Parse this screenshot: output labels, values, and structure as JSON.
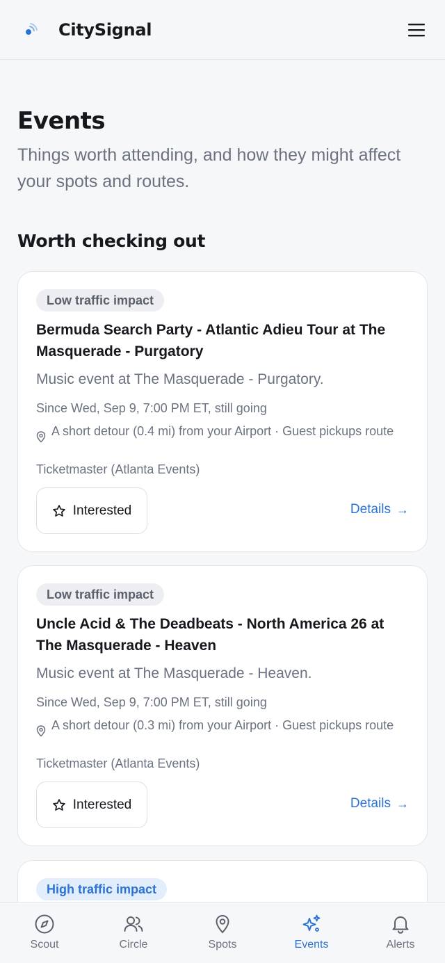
{
  "app": {
    "name": "CitySignal",
    "accent": "#2b73d6"
  },
  "header": {
    "menu_icon": "hamburger-menu-icon"
  },
  "page": {
    "title": "Events",
    "subtitle": "Things worth attending, and how they might affect your spots and routes.",
    "section_title": "Worth checking out"
  },
  "events": [
    {
      "badge": "Low traffic impact",
      "badge_level": "low",
      "title": "Bermuda Search Party - Atlantic Adieu Tour at The Masquerade - Purgatory",
      "description": "Music event at The Masquerade - Purgatory.",
      "when": "Since Wed, Sep 9, 7:00 PM ET, still going",
      "location": "A short detour (0.4 mi) from your Airport · Guest pickups route",
      "source": "Ticketmaster (Atlanta Events)",
      "interested_label": "Interested",
      "details_label": "Details"
    },
    {
      "badge": "Low traffic impact",
      "badge_level": "low",
      "title": "Uncle Acid & The Deadbeats - North America 26 at The Masquerade - Heaven",
      "description": "Music event at The Masquerade - Heaven.",
      "when": "Since Wed, Sep 9, 7:00 PM ET, still going",
      "location": "A short detour (0.3 mi) from your Airport · Guest pickups route",
      "source": "Ticketmaster (Atlanta Events)",
      "interested_label": "Interested",
      "details_label": "Details"
    },
    {
      "badge": "High traffic impact",
      "badge_level": "high"
    }
  ],
  "nav": {
    "active": "Events",
    "items": [
      {
        "label": "Scout",
        "icon": "compass-icon"
      },
      {
        "label": "Circle",
        "icon": "people-icon"
      },
      {
        "label": "Spots",
        "icon": "map-pin-icon"
      },
      {
        "label": "Events",
        "icon": "sparkles-icon"
      },
      {
        "label": "Alerts",
        "icon": "bell-icon"
      }
    ]
  }
}
